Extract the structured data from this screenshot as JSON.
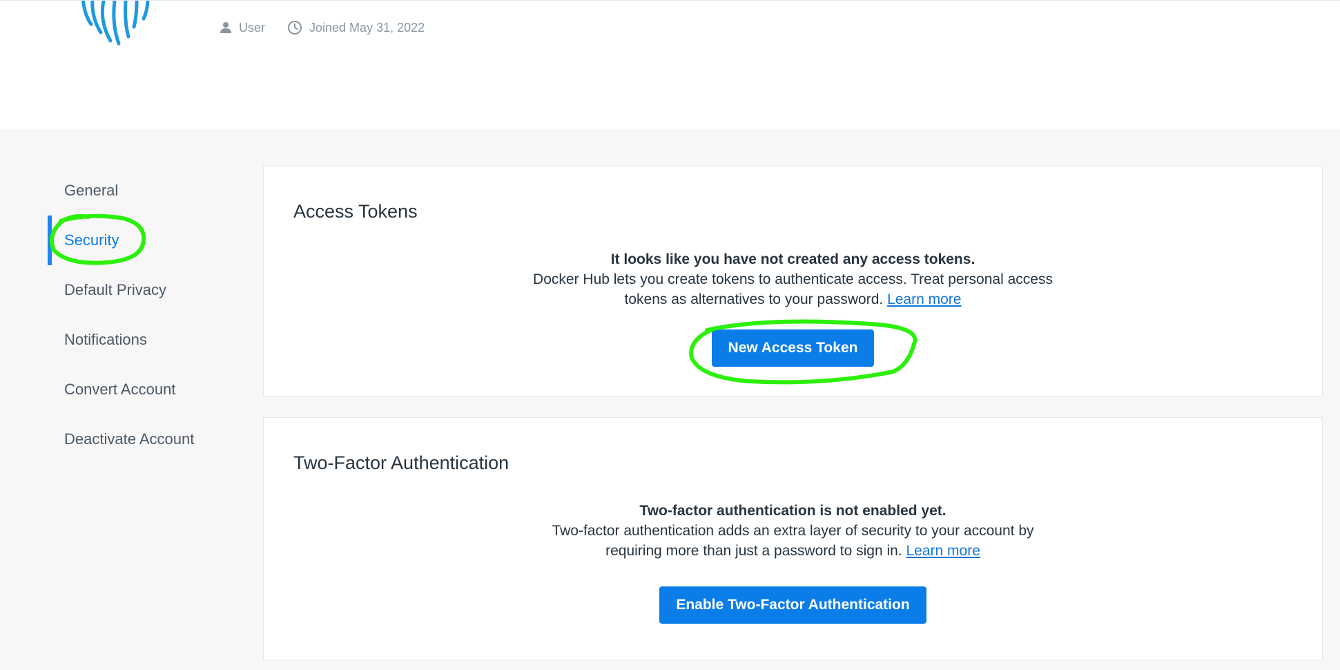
{
  "header": {
    "user_label": "User",
    "joined_label": "Joined May 31, 2022"
  },
  "sidebar": {
    "items": [
      {
        "label": "General"
      },
      {
        "label": "Security"
      },
      {
        "label": "Default Privacy"
      },
      {
        "label": "Notifications"
      },
      {
        "label": "Convert Account"
      },
      {
        "label": "Deactivate Account"
      }
    ],
    "active": "Security"
  },
  "access_tokens": {
    "title": "Access Tokens",
    "headline": "It looks like you have not created any access tokens.",
    "description": "Docker Hub lets you create tokens to authenticate access. Treat personal access tokens as alternatives to your password.",
    "learn_more": "Learn more",
    "button": "New Access Token"
  },
  "two_factor": {
    "title": "Two-Factor Authentication",
    "headline": "Two-factor authentication is not enabled yet.",
    "description": "Two-factor authentication adds an extra layer of security to your account by requiring more than just a password to sign in.",
    "learn_more": "Learn more",
    "button": "Enable Two-Factor Authentication"
  },
  "colors": {
    "accent": "#0b7de8",
    "annotation": "#2cf00a"
  },
  "icons": {
    "avatar": "fingerprint-icon",
    "user": "user-icon",
    "joined": "clock-icon"
  }
}
